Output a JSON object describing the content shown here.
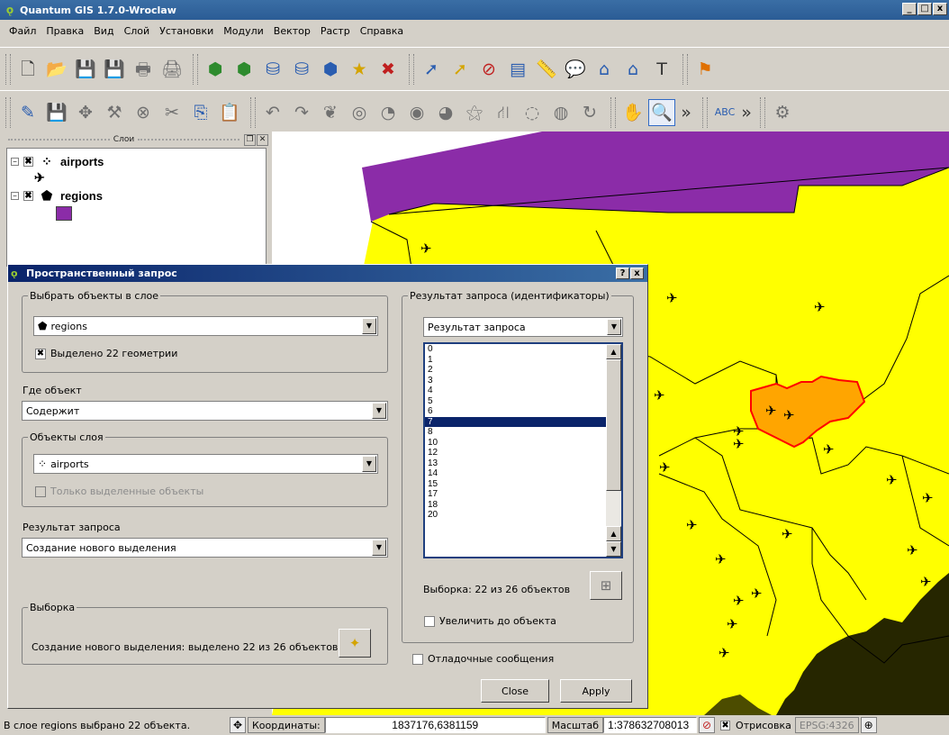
{
  "window": {
    "title": "Quantum GIS 1.7.0-Wroclaw",
    "controls": [
      "_",
      "□",
      "x"
    ]
  },
  "menubar": [
    "Файл",
    "Правка",
    "Вид",
    "Слой",
    "Установки",
    "Модули",
    "Вектор",
    "Растр",
    "Справка"
  ],
  "toolbar1_icons": [
    "new-project-icon",
    "open-project-icon",
    "save-project-icon",
    "save-as-icon",
    "print-composer-icon",
    "print-icon",
    "add-vector-layer-icon",
    "add-raster-layer-icon",
    "add-postgis-layer-icon",
    "add-spatialite-layer-icon",
    "add-wms-layer-icon",
    "add-wfs-layer-icon",
    "remove-layer-icon",
    "identify-icon",
    "select-icon",
    "deselect-icon",
    "attribute-table-icon",
    "measure-icon",
    "map-tips-icon",
    "zoom-full-icon",
    "zoom-home-icon",
    "text-annotation-icon",
    "new-bookmark-icon"
  ],
  "toolbar2_icons": [
    "toggle-edit-icon",
    "save-edits-icon",
    "move-feature-icon",
    "node-tool-icon",
    "delete-selected-icon",
    "cut-features-icon",
    "copy-features-icon",
    "paste-features-icon",
    "undo-icon",
    "redo-icon",
    "simplify-feature-icon",
    "add-ring-icon",
    "add-part-icon",
    "delete-ring-icon",
    "delete-part-icon",
    "reshape-icon",
    "split-features-icon",
    "merge-features-icon",
    "rotate-icon",
    "pan-icon",
    "zoom-in-icon",
    "overflow-icon",
    "label-tool-icon",
    "overflow-icon",
    "raster-tool-icon"
  ],
  "layers_panel": {
    "title": "Слои",
    "layers": [
      {
        "name": "airports",
        "checked": "✖",
        "expander": "−",
        "icon": "point-layer-icon",
        "legend": "airplane-symbol-icon"
      },
      {
        "name": "regions",
        "checked": "✖",
        "expander": "−",
        "icon": "polygon-layer-icon",
        "legend_color": "#8b2ca8"
      }
    ]
  },
  "map": {
    "colors": {
      "background": "#ffff00",
      "north_region": "#8b2ca8",
      "selected_region": "#ffa500",
      "selected_outline": "#ff0000"
    }
  },
  "dialog": {
    "title": "Пространственный запрос",
    "controls": [
      "?",
      "x"
    ],
    "select_layer_group": "Выбрать объекты в слое",
    "select_layer_value": "regions",
    "selected_geometries": "Выделено 22 геометрии",
    "where_label": "Где объект",
    "operation_value": "Содержит",
    "ref_layer_group": "Объекты слоя",
    "ref_layer_value": "airports",
    "only_selected_label": "Только выделенные объекты",
    "result_label": "Результат запроса",
    "result_value": "Создание нового выделения",
    "selection_group": "Выборка",
    "selection_text": "Создание нового выделения: выделено 22 из 26 объектов",
    "result_ids_group": "Результат запроса (идентификаторы)",
    "result_ids_combo": "Результат запроса",
    "ids": [
      "0",
      "1",
      "2",
      "3",
      "4",
      "5",
      "6",
      "7",
      "8",
      "10",
      "12",
      "13",
      "14",
      "15",
      "17",
      "18",
      "20"
    ],
    "selected_id": "7",
    "ids_count_text": "Выборка: 22 из 26 объектов",
    "zoom_to_object_label": "Увеличить до объекта",
    "debug_label": "Отладочные сообщения",
    "close_label": "Close",
    "apply_label": "Apply"
  },
  "statusbar": {
    "message": "В слое regions выбрано 22 объекта.",
    "coords_label": "Координаты:",
    "coords_value": "1837176,6381159",
    "scale_label": "Масштаб",
    "scale_value": "1:378632708013",
    "render_label": "Отрисовка",
    "render_checked": "✖",
    "crs_label": "EPSG:4326"
  }
}
